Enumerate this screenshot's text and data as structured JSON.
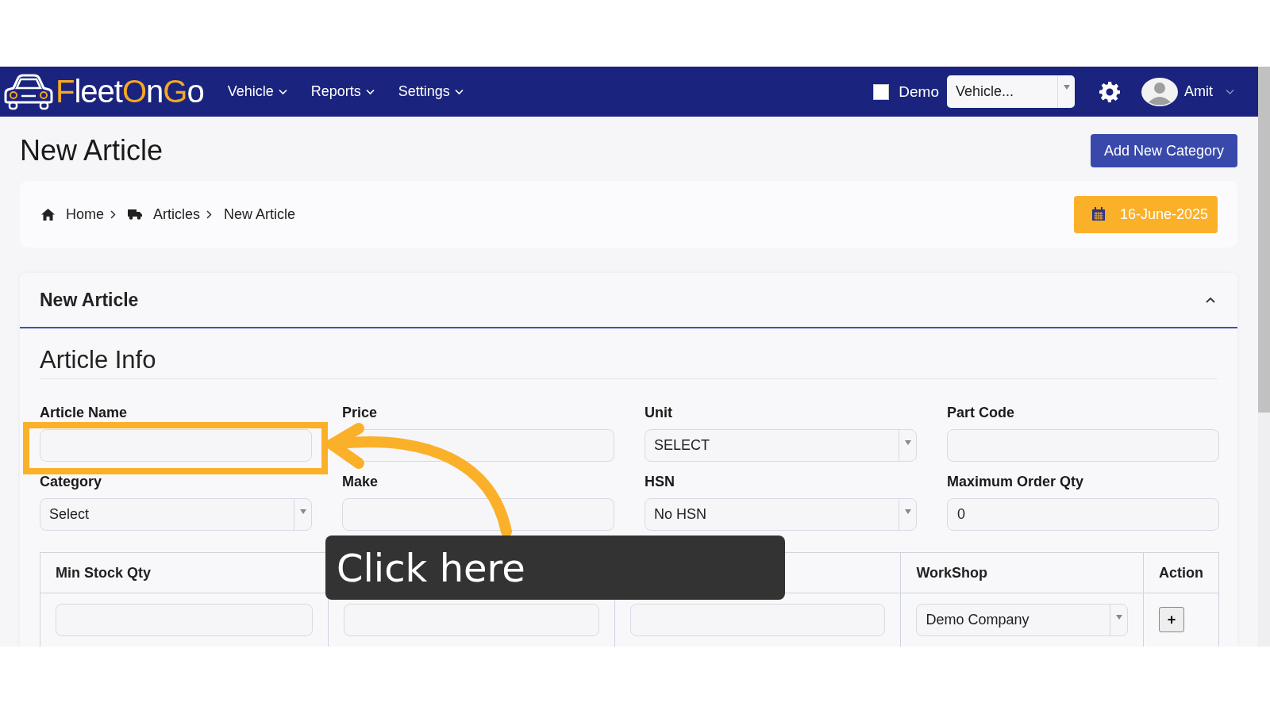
{
  "navbar": {
    "brand": [
      {
        "text": "F",
        "accent": true
      },
      {
        "text": "leet",
        "accent": false
      },
      {
        "text": "O",
        "accent": true
      },
      {
        "text": "n",
        "accent": false
      },
      {
        "text": "G",
        "accent": true
      },
      {
        "text": "o",
        "accent": false
      }
    ],
    "menus": [
      {
        "label": "Vehicle"
      },
      {
        "label": "Reports"
      },
      {
        "label": "Settings"
      }
    ],
    "demo": {
      "label": "Demo",
      "checked": false
    },
    "vehicle_select": {
      "value": "Vehicle..."
    },
    "user": {
      "name": "Amit"
    }
  },
  "page_title": "New Article",
  "add_button": "Add New Category",
  "breadcrumb": [
    {
      "label": "Home"
    },
    {
      "label": "Articles"
    },
    {
      "label": "New Article"
    }
  ],
  "date": "16-June-2025",
  "card": {
    "title": "New Article",
    "expanded": true,
    "section": "Article Info",
    "fields": [
      {
        "label": "Article Name",
        "kind": "input"
      },
      {
        "label": "Price",
        "kind": "input"
      },
      {
        "label": "Unit",
        "kind": "select",
        "value": "SELECT"
      },
      {
        "label": "Part Code",
        "kind": "input"
      },
      {
        "label": "Category",
        "kind": "select",
        "value": "Select"
      },
      {
        "label": "Make",
        "kind": "input"
      },
      {
        "label": "HSN",
        "kind": "select",
        "value": "No HSN"
      },
      {
        "label": "Maximum Order Qty",
        "kind": "input",
        "value": "0"
      }
    ],
    "table": {
      "columns": [
        "Min Stock Qty",
        null,
        null,
        "WorkShop",
        "Action"
      ],
      "row": [
        {
          "kind": "input"
        },
        {
          "kind": "input"
        },
        {
          "kind": "input"
        },
        {
          "kind": "select",
          "value": "Demo Company"
        },
        {
          "kind": "button",
          "value": "+"
        }
      ]
    }
  },
  "guide": {
    "tooltip": "Click here"
  }
}
